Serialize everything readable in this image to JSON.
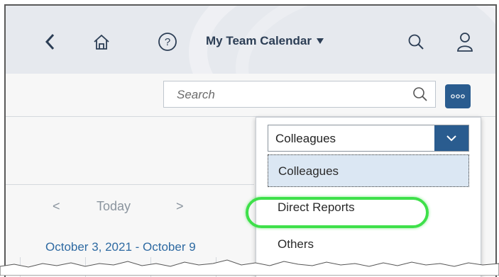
{
  "shell": {
    "title": "My Team Calendar",
    "icons": [
      "back-icon",
      "home-icon",
      "help-icon",
      "caret-down-icon",
      "search-icon",
      "user-icon"
    ]
  },
  "toolbar": {
    "search_placeholder": "Search",
    "more_icon": "overflow-icon"
  },
  "calendar": {
    "today_label": "Today",
    "range_label": "October 3, 2021 - October 9"
  },
  "dropdown": {
    "selected": "Colleagues",
    "options": [
      "Colleagues",
      "Direct Reports",
      "Others"
    ]
  },
  "colors": {
    "shellbar": "#e6e9ee",
    "accent": "#2a5c8f",
    "link": "#2e6aa2",
    "highlight": "#3ee04a",
    "selected_bg": "#dbe7f3"
  }
}
